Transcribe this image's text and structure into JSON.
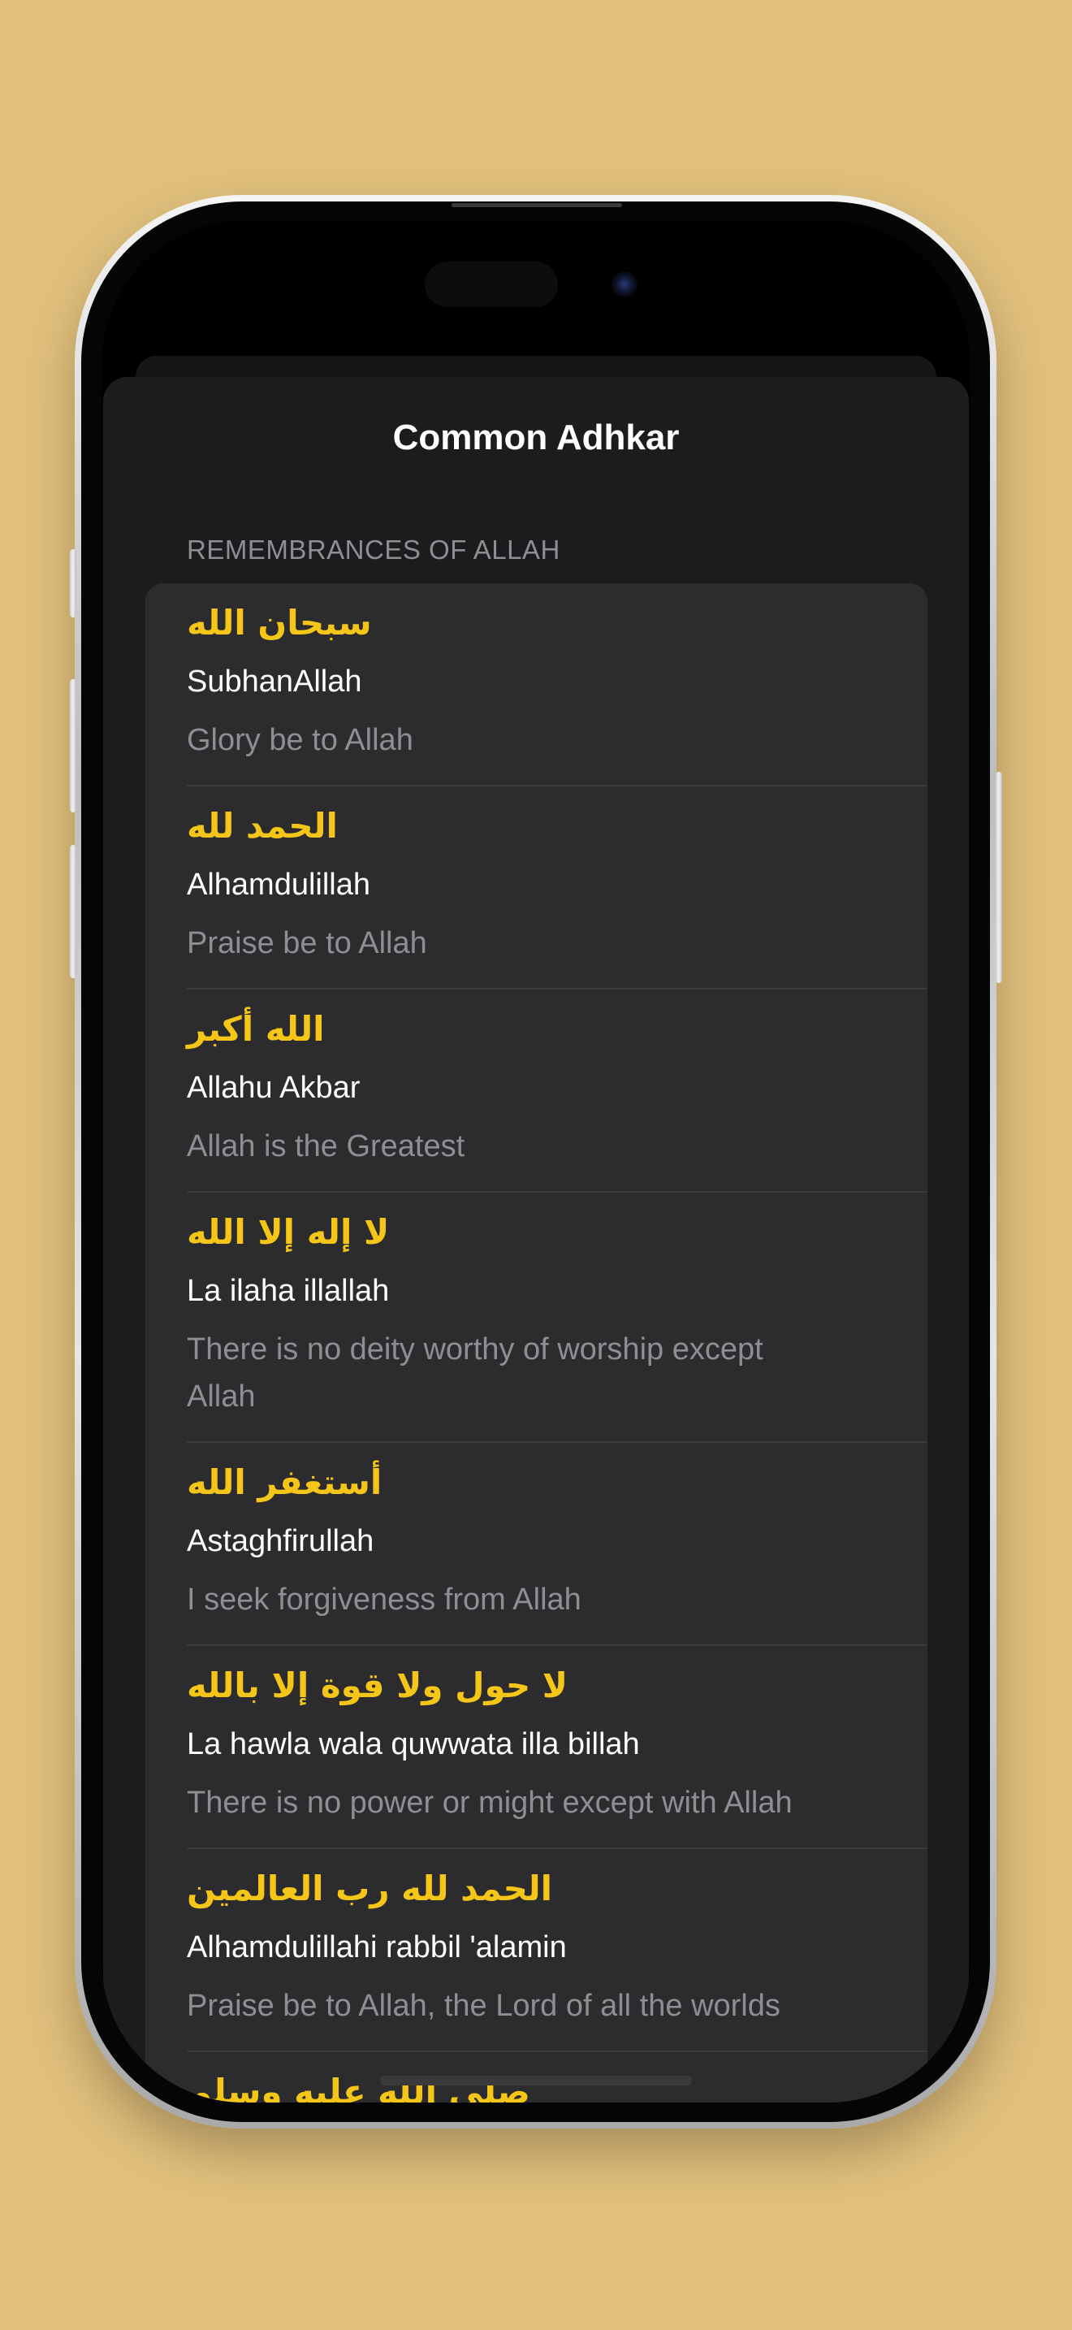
{
  "sheet": {
    "title": "Common Adhkar"
  },
  "section": {
    "header": "REMEMBRANCES OF ALLAH"
  },
  "adhkar": [
    {
      "arabic": "سبحان الله",
      "transliteration": "SubhanAllah",
      "meaning": "Glory be to Allah"
    },
    {
      "arabic": "الحمد لله",
      "transliteration": "Alhamdulillah",
      "meaning": "Praise be to Allah"
    },
    {
      "arabic": "الله أكبر",
      "transliteration": "Allahu Akbar",
      "meaning": "Allah is the Greatest"
    },
    {
      "arabic": "لا إله إلا الله",
      "transliteration": "La ilaha illallah",
      "meaning": "There is no deity worthy of worship except Allah"
    },
    {
      "arabic": "أستغفر الله",
      "transliteration": "Astaghfirullah",
      "meaning": "I seek forgiveness from Allah"
    },
    {
      "arabic": "لا حول ولا قوة إلا بالله",
      "transliteration": "La hawla wala quwwata illa billah",
      "meaning": "There is no power or might except with Allah"
    },
    {
      "arabic": "الحمد لله رب العالمين",
      "transliteration": "Alhamdulillahi rabbil 'alamin",
      "meaning": "Praise be to Allah, the Lord of all the worlds"
    },
    {
      "arabic": "صلى الله عليه وسلم"
    }
  ],
  "colors": {
    "background": "#e1c07c",
    "sheet": "#1c1c1e",
    "card": "#2c2c2e",
    "arabic_text": "#f5c518",
    "primary_text": "#ffffff",
    "secondary_text": "#8e8e93",
    "separator": "#3a3a3c"
  }
}
